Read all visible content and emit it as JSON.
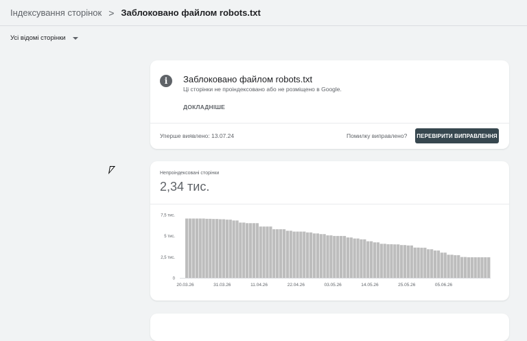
{
  "breadcrumb": {
    "parent": "Індексування сторінок",
    "separator": ">",
    "current": "Заблоковано файлом robots.txt"
  },
  "filter": {
    "label": "Усі відомі сторінки"
  },
  "issue_card": {
    "title": "Заблоковано файлом robots.txt",
    "description": "Ці сторінки не проіндексовано або не розміщено в Google.",
    "details_link": "ДОКЛАДНІШЕ",
    "first_detected": "Уперше виявлено: 13.07.24",
    "fixed_question": "Помилку виправлено?",
    "validate_button": "ПЕРЕВІРИТИ ВИПРАВЛЕННЯ"
  },
  "metric_card": {
    "label": "Непроіндексовані сторінки",
    "value": "2,34 тис."
  },
  "colors": {
    "bar": "#bdbdbd",
    "button": "#37474f",
    "info_icon": "#5f6368"
  },
  "chart_data": {
    "type": "bar",
    "ylim": [
      0,
      7500
    ],
    "yticks": [
      {
        "value": 0,
        "label": "0"
      },
      {
        "value": 2500,
        "label": "2,5 тис."
      },
      {
        "value": 5000,
        "label": "5 тис."
      },
      {
        "value": 7500,
        "label": "7,5 тис."
      }
    ],
    "xtick_labels": [
      "20.03.26",
      "31.03.26",
      "11.04.26",
      "22.04.26",
      "03.05.26",
      "14.05.26",
      "25.05.26",
      "05.06.26"
    ],
    "xtick_index": [
      0,
      11,
      22,
      33,
      44,
      55,
      66,
      77
    ],
    "values": [
      7050,
      7050,
      7050,
      7050,
      7050,
      7050,
      7020,
      7020,
      7000,
      7000,
      6970,
      6970,
      6920,
      6920,
      6820,
      6820,
      6570,
      6570,
      6500,
      6500,
      6500,
      6500,
      6100,
      6100,
      6100,
      6100,
      5780,
      5780,
      5780,
      5780,
      5600,
      5600,
      5500,
      5500,
      5500,
      5500,
      5400,
      5400,
      5280,
      5280,
      5200,
      5200,
      5050,
      5050,
      4980,
      4980,
      4980,
      4980,
      4800,
      4800,
      4680,
      4680,
      4580,
      4580,
      4350,
      4350,
      4220,
      4220,
      4050,
      4050,
      4000,
      4000,
      3980,
      3980,
      3900,
      3900,
      3850,
      3850,
      3600,
      3600,
      3580,
      3580,
      3400,
      3400,
      3250,
      3250,
      3000,
      3000,
      2750,
      2750,
      2700,
      2700,
      2480,
      2480,
      2450,
      2450,
      2450,
      2450,
      2450,
      2450,
      2450
    ]
  }
}
